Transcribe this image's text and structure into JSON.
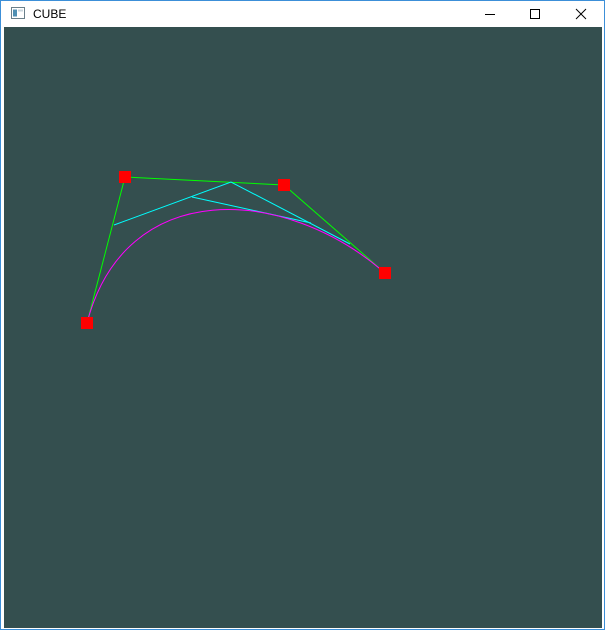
{
  "window": {
    "title": "CUBE",
    "controls": {
      "minimize_icon": "minimize-icon",
      "maximize_icon": "maximize-icon",
      "close_icon": "close-icon"
    }
  },
  "scene": {
    "background_color": "#344f4f",
    "control_polygon_color": "#00ff00",
    "construction_color": "#00ffff",
    "curve_color": "#ff00ff",
    "control_point_color": "#ff0000"
  }
}
